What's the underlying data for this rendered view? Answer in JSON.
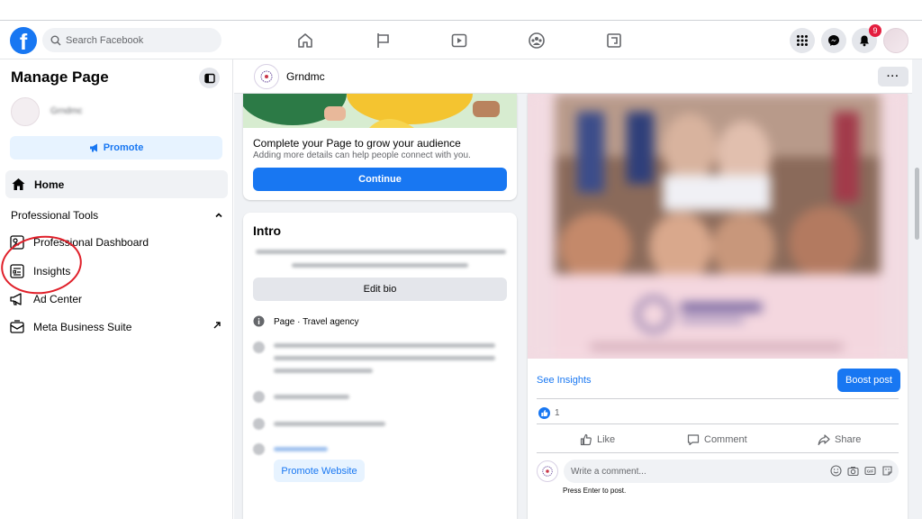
{
  "topbar": {
    "logo": "f",
    "search_placeholder": "Search Facebook",
    "notification_count": "9",
    "icons": [
      "home-icon",
      "flag-icon",
      "watch-icon",
      "groups-icon",
      "gaming-icon",
      "menu-grid-icon",
      "messenger-icon",
      "bell-icon"
    ]
  },
  "sidebar": {
    "title": "Manage Page",
    "page_name": "Grndmc",
    "promote_label": "Promote",
    "home_label": "Home",
    "professional_tools_label": "Professional Tools",
    "items": [
      {
        "label": "Professional Dashboard",
        "icon": "dashboard-icon"
      },
      {
        "label": "Insights",
        "icon": "insights-icon"
      },
      {
        "label": "Ad Center",
        "icon": "megaphone-icon"
      },
      {
        "label": "Meta Business Suite",
        "icon": "business-suite-icon"
      }
    ]
  },
  "page_header": {
    "name": "Grndmc",
    "more_label": "···"
  },
  "complete_card": {
    "title": "Complete your Page to grow your audience",
    "subtitle": "Adding more details can help people connect with you.",
    "continue_label": "Continue"
  },
  "intro": {
    "title": "Intro",
    "edit_bio_label": "Edit bio",
    "page_label": "Page",
    "page_category": " · Travel agency",
    "promote_website_label": "Promote Website"
  },
  "post": {
    "see_insights_label": "See Insights",
    "boost_label": "Boost post",
    "like_count": "1",
    "like_label": "Like",
    "comment_label": "Comment",
    "share_label": "Share",
    "comment_placeholder": "Write a comment...",
    "press_enter_hint": "Press Enter to post."
  },
  "colors": {
    "accent": "#1877f2",
    "annotation": "#e0202a"
  }
}
